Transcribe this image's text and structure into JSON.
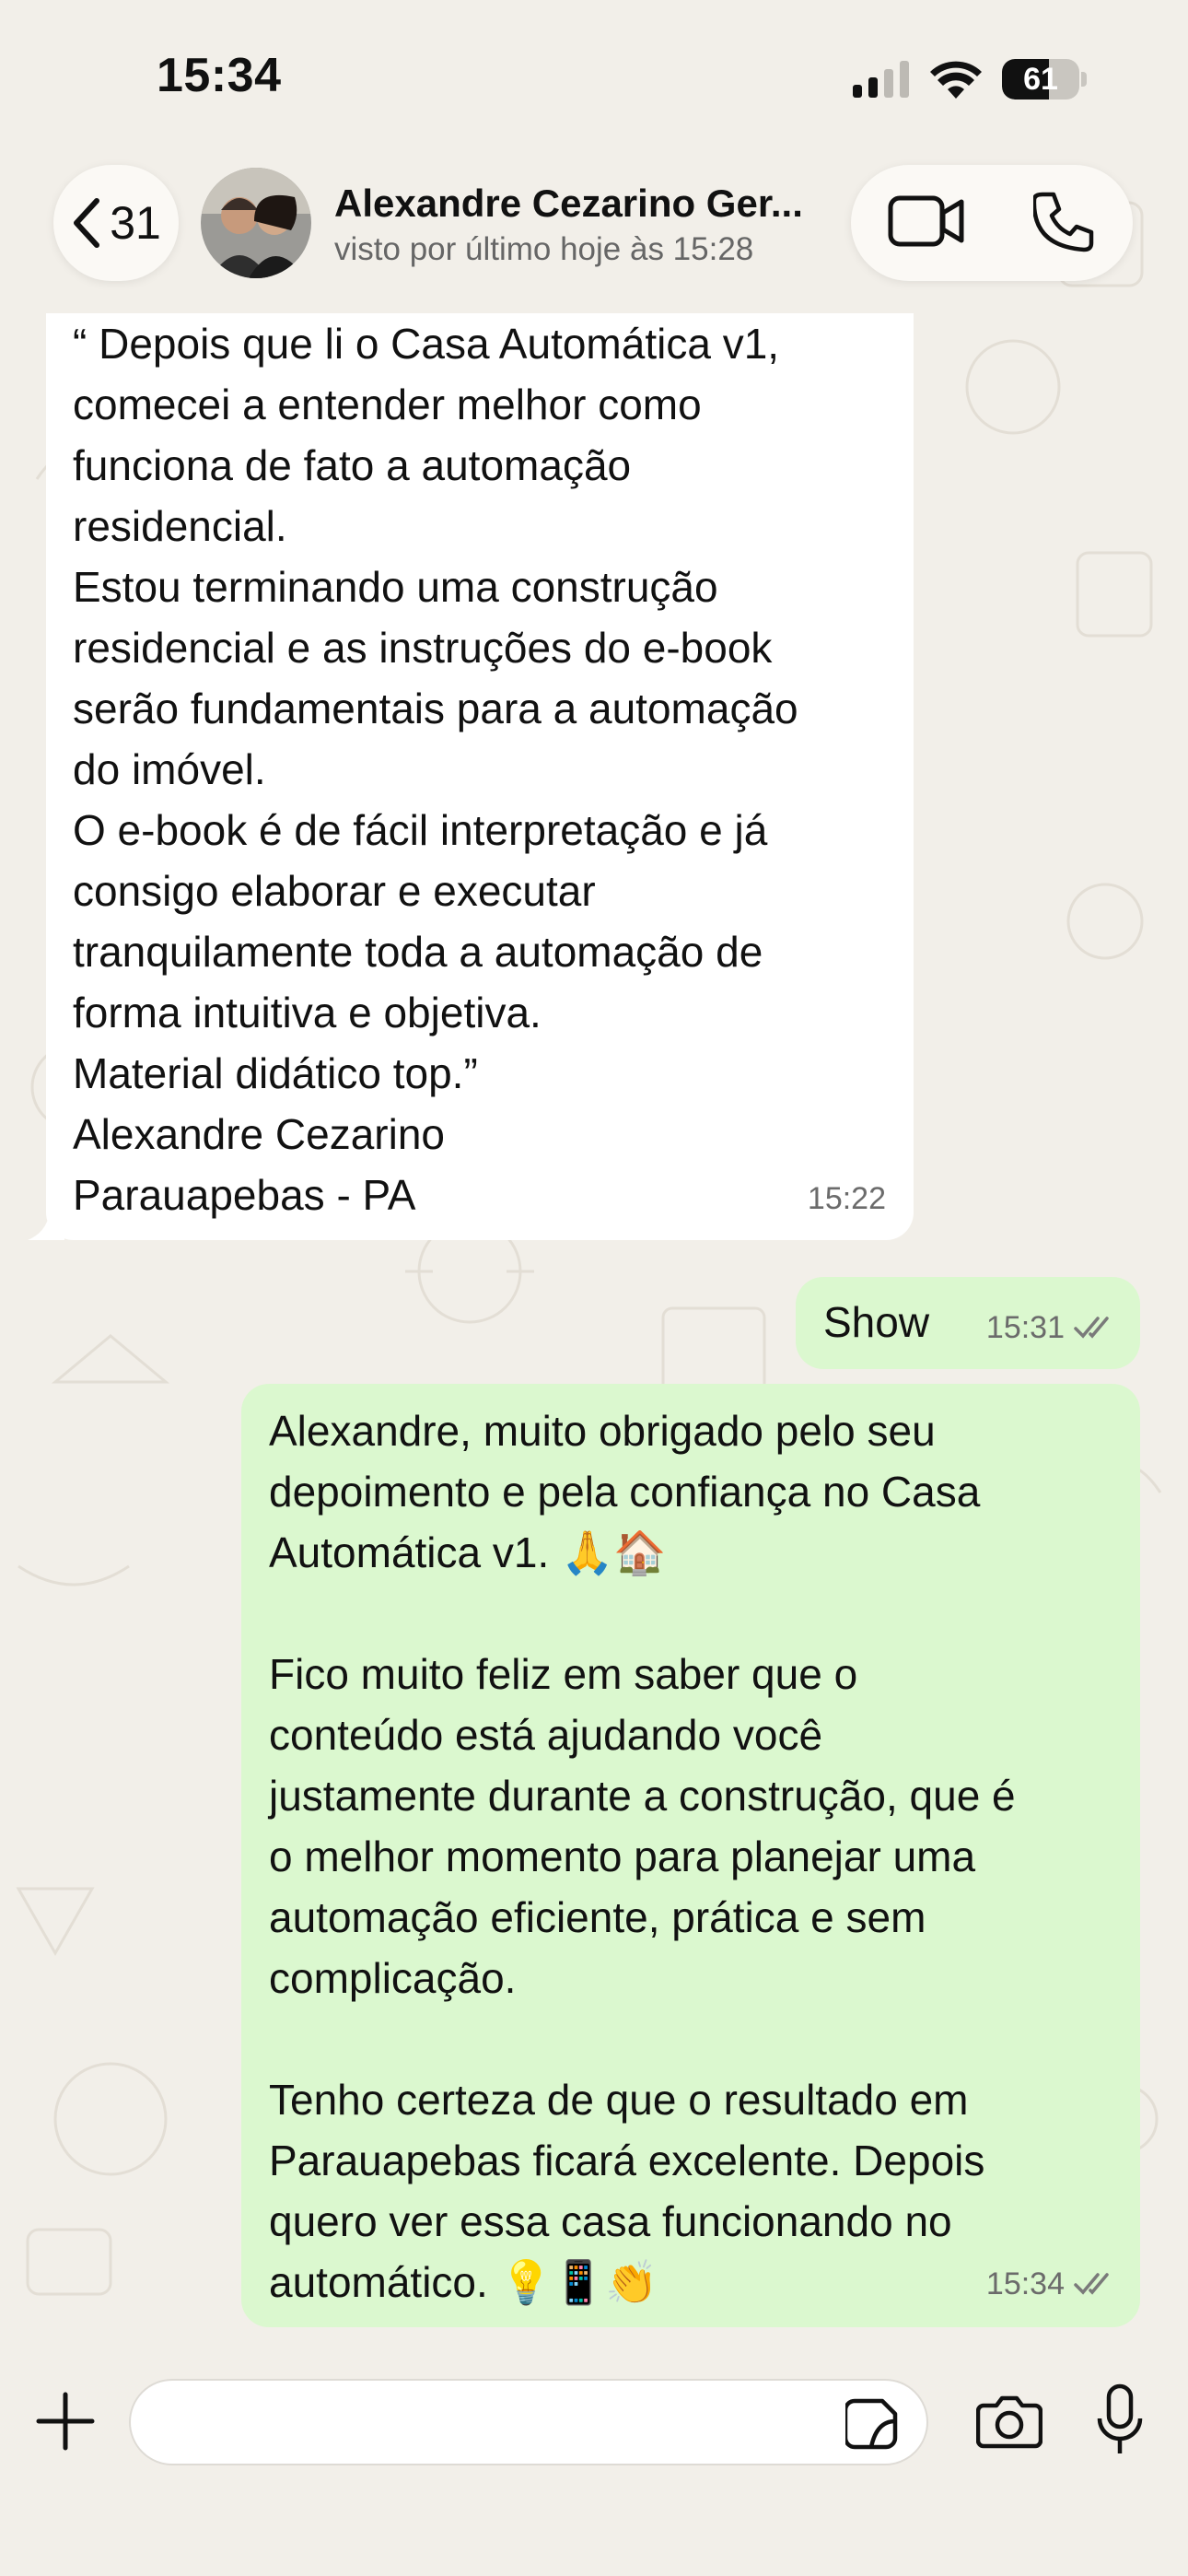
{
  "status_bar": {
    "time": "15:34",
    "battery": "61",
    "battery_level": 0.61
  },
  "header": {
    "back_count": "31",
    "contact_name": "Alexandre Cezarino Ger...",
    "contact_status": "visto por último hoje às 15:28",
    "icons": [
      "chevron-left-icon",
      "video-call-icon",
      "phone-call-icon"
    ]
  },
  "messages": [
    {
      "direction": "in",
      "lines": [
        "“ Depois que li o Casa Automática v1,",
        "comecei a entender melhor como",
        "funciona de fato a automação",
        "residencial.",
        "Estou terminando uma construção",
        "residencial e as instruções do e-book",
        "serão fundamentais para a automação",
        "do imóvel.",
        "O e-book é de fácil interpretação e já",
        "consigo elaborar e executar",
        "tranquilamente toda a automação de",
        "forma intuitiva e objetiva.",
        "Material didático top.”",
        "Alexandre Cezarino",
        "Parauapebas - PA"
      ],
      "time": "15:22"
    },
    {
      "direction": "out",
      "lines": [
        "Show"
      ],
      "time": "15:31",
      "read_receipt": "double-check-icon"
    },
    {
      "direction": "out",
      "lines": [
        "Alexandre, muito obrigado pelo seu",
        "depoimento e pela confiança no Casa",
        "Automática v1. 🙏🏠",
        "",
        "Fico muito feliz em saber que o",
        "conteúdo está ajudando você",
        "justamente durante a construção, que é",
        "o melhor momento para planejar uma",
        "automação eficiente, prática e sem",
        "complicação.",
        "",
        "Tenho certeza de que o resultado em",
        "Parauapebas ficará excelente. Depois",
        "quero ver essa casa funcionando no",
        "automático. 💡📱👏"
      ],
      "time": "15:34",
      "read_receipt": "double-check-icon"
    }
  ],
  "composer": {
    "value": "",
    "icons": [
      "plus-icon",
      "sticker-icon",
      "camera-icon",
      "microphone-icon"
    ]
  },
  "colors": {
    "background": "#f2efe9",
    "incoming_bubble": "#ffffff",
    "outgoing_bubble": "#dbf8cf",
    "read_check": "#7a7a7a"
  }
}
